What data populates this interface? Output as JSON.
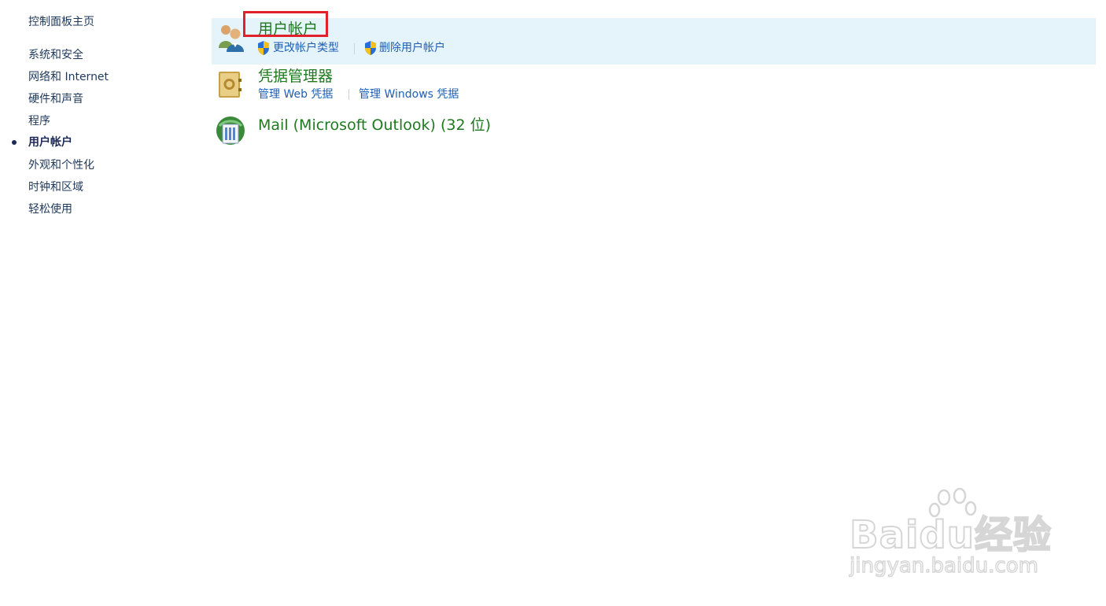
{
  "sidebar": {
    "home": "控制面板主页",
    "items": [
      {
        "label": "系统和安全"
      },
      {
        "label": "网络和 Internet"
      },
      {
        "label": "硬件和声音"
      },
      {
        "label": "程序"
      },
      {
        "label": "用户帐户",
        "active": true
      },
      {
        "label": "外观和个性化"
      },
      {
        "label": "时钟和区域"
      },
      {
        "label": "轻松使用"
      }
    ]
  },
  "main": {
    "categories": [
      {
        "title": "用户帐户",
        "icon": "users-icon",
        "links": [
          "更改帐户类型",
          "删除用户帐户"
        ]
      },
      {
        "title": "凭据管理器",
        "icon": "credential-vault-icon",
        "links": [
          "管理 Web 凭据",
          "管理 Windows 凭据"
        ]
      },
      {
        "title": "Mail (Microsoft Outlook) (32 位)",
        "icon": "mail-icon",
        "links": []
      }
    ]
  },
  "watermark": {
    "brand": "Baidu经验",
    "url": "jingyan.baidu.com"
  },
  "colors": {
    "title_green": "#1e7a1e",
    "link_blue": "#1f5fb3",
    "highlight": "#e5f3fb",
    "annotation_red": "#e0202a"
  }
}
